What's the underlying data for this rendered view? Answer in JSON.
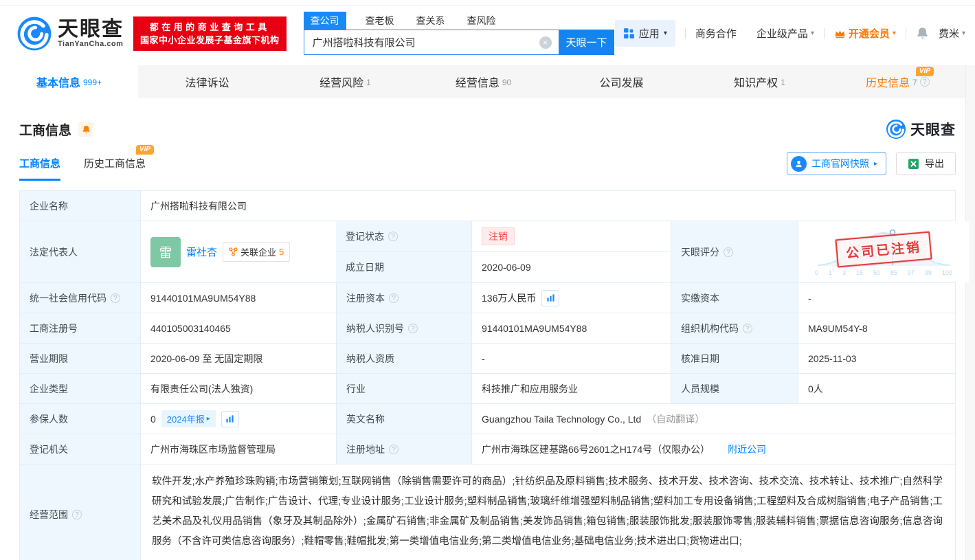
{
  "colors": {
    "brand_blue": "#1989fa",
    "link_blue": "#0084ff",
    "vip_orange": "#ff7800",
    "brand_red": "#e60012",
    "status_red": "#f04b4b",
    "stamp_red": "#e23b3b",
    "avatar_green": "#7ec8a6",
    "label_bg": "#eef7fd"
  },
  "icons": {
    "help": "?",
    "caret": "▾",
    "arrow": "▸",
    "clear": "×"
  },
  "badges": {
    "vip": "VIP"
  },
  "header": {
    "logo": {
      "brand": "天眼查",
      "domain": "TianYanCha.com"
    },
    "slogan": {
      "line1": "都在用的商业查询工具",
      "line2": "国家中小企业发展子基金旗下机构"
    },
    "search": {
      "tabs": [
        {
          "label": "查公司"
        },
        {
          "label": "查老板"
        },
        {
          "label": "查关系"
        },
        {
          "label": "查风险"
        }
      ],
      "value": "广州搭啦科技有限公司",
      "button": "天眼一下"
    },
    "nav": {
      "apps": "应用",
      "cooperation": "商务合作",
      "enterprise": "企业级产品",
      "vip": "开通会员",
      "user": "费米"
    }
  },
  "tabbar": {
    "items": [
      {
        "label": "基本信息",
        "count": "999+"
      },
      {
        "label": "法律诉讼",
        "count": ""
      },
      {
        "label": "经营风险",
        "count": "1"
      },
      {
        "label": "经营信息",
        "count": "90"
      },
      {
        "label": "公司发展",
        "count": ""
      },
      {
        "label": "知识产权",
        "count": "1"
      },
      {
        "label": "历史信息",
        "count": "7"
      }
    ]
  },
  "section": {
    "title": "工商信息",
    "subtabs": [
      {
        "label": "工商信息"
      },
      {
        "label": "历史工商信息"
      }
    ],
    "snapshot_button": "工商官网快照",
    "export_button": "导出",
    "watermark_brand": "天眼查"
  },
  "table": {
    "company_name_label": "企业名称",
    "company_name": "广州搭啦科技有限公司",
    "legal_rep_label": "法定代表人",
    "legal_rep": {
      "avatar_char": "雷",
      "name": "雷社杏",
      "related_label": "关联企业",
      "related_count": "5"
    },
    "reg_status_label": "登记状态",
    "reg_status": "注销",
    "establish_date_label": "成立日期",
    "establish_date": "2020-06-09",
    "score_label": "天眼评分",
    "score_stamp": "公司已注销",
    "score_ticks": [
      "0",
      "1",
      "3",
      "15",
      "50",
      "85",
      "97",
      "99",
      "100"
    ],
    "credit_code_label": "统一社会信用代码",
    "credit_code": "91440101MA9UM54Y88",
    "reg_capital_label": "注册资本",
    "reg_capital": "136万人民币",
    "paid_capital_label": "实缴资本",
    "paid_capital": "-",
    "reg_number_label": "工商注册号",
    "reg_number": "440105003140465",
    "taxpayer_id_label": "纳税人识别号",
    "taxpayer_id": "91440101MA9UM54Y88",
    "org_code_label": "组织机构代码",
    "org_code": "MA9UM54Y-8",
    "business_term_label": "营业期限",
    "business_term": "2020-06-09 至 无固定期限",
    "taxpayer_quality_label": "纳税人资质",
    "taxpayer_quality": "-",
    "approval_date_label": "核准日期",
    "approval_date": "2025-11-03",
    "company_type_label": "企业类型",
    "company_type": "有限责任公司(法人独资)",
    "industry_label": "行业",
    "industry": "科技推广和应用服务业",
    "staff_size_label": "人员规模",
    "staff_size": "0人",
    "insured_label": "参保人数",
    "insured_value": "0",
    "insured_badge": "2024年报",
    "english_name_label": "英文名称",
    "english_name": "Guangzhou Taila Technology Co., Ltd",
    "english_name_note": "（自动翻译）",
    "reg_authority_label": "登记机关",
    "reg_authority": "广州市海珠区市场监督管理局",
    "reg_address_label": "注册地址",
    "reg_address": "广州市海珠区建基路66号2601之H174号（仅限办公）",
    "nearby_link": "附近公司",
    "business_scope_label": "经营范围",
    "business_scope": "软件开发;水产养殖珍珠购销;市场营销策划;互联网销售（除销售需要许可的商品）;针纺织品及原料销售;技术服务、技术开发、技术咨询、技术交流、技术转让、技术推广;自然科学研究和试验发展;广告制作;广告设计、代理;专业设计服务;工业设计服务;塑料制品销售;玻璃纤维增强塑料制品销售;塑料加工专用设备销售;工程塑料及合成树脂销售;电子产品销售;工艺美术品及礼仪用品销售（象牙及其制品除外）;金属矿石销售;非金属矿及制品销售;美发饰品销售;箱包销售;服装服饰批发;服装服饰零售;服装辅料销售;票据信息咨询服务;信息咨询服务（不含许可类信息咨询服务）;鞋帽零售;鞋帽批发;第一类增值电信业务;第二类增值电信业务;基础电信业务;技术进出口;货物进出口;"
  }
}
